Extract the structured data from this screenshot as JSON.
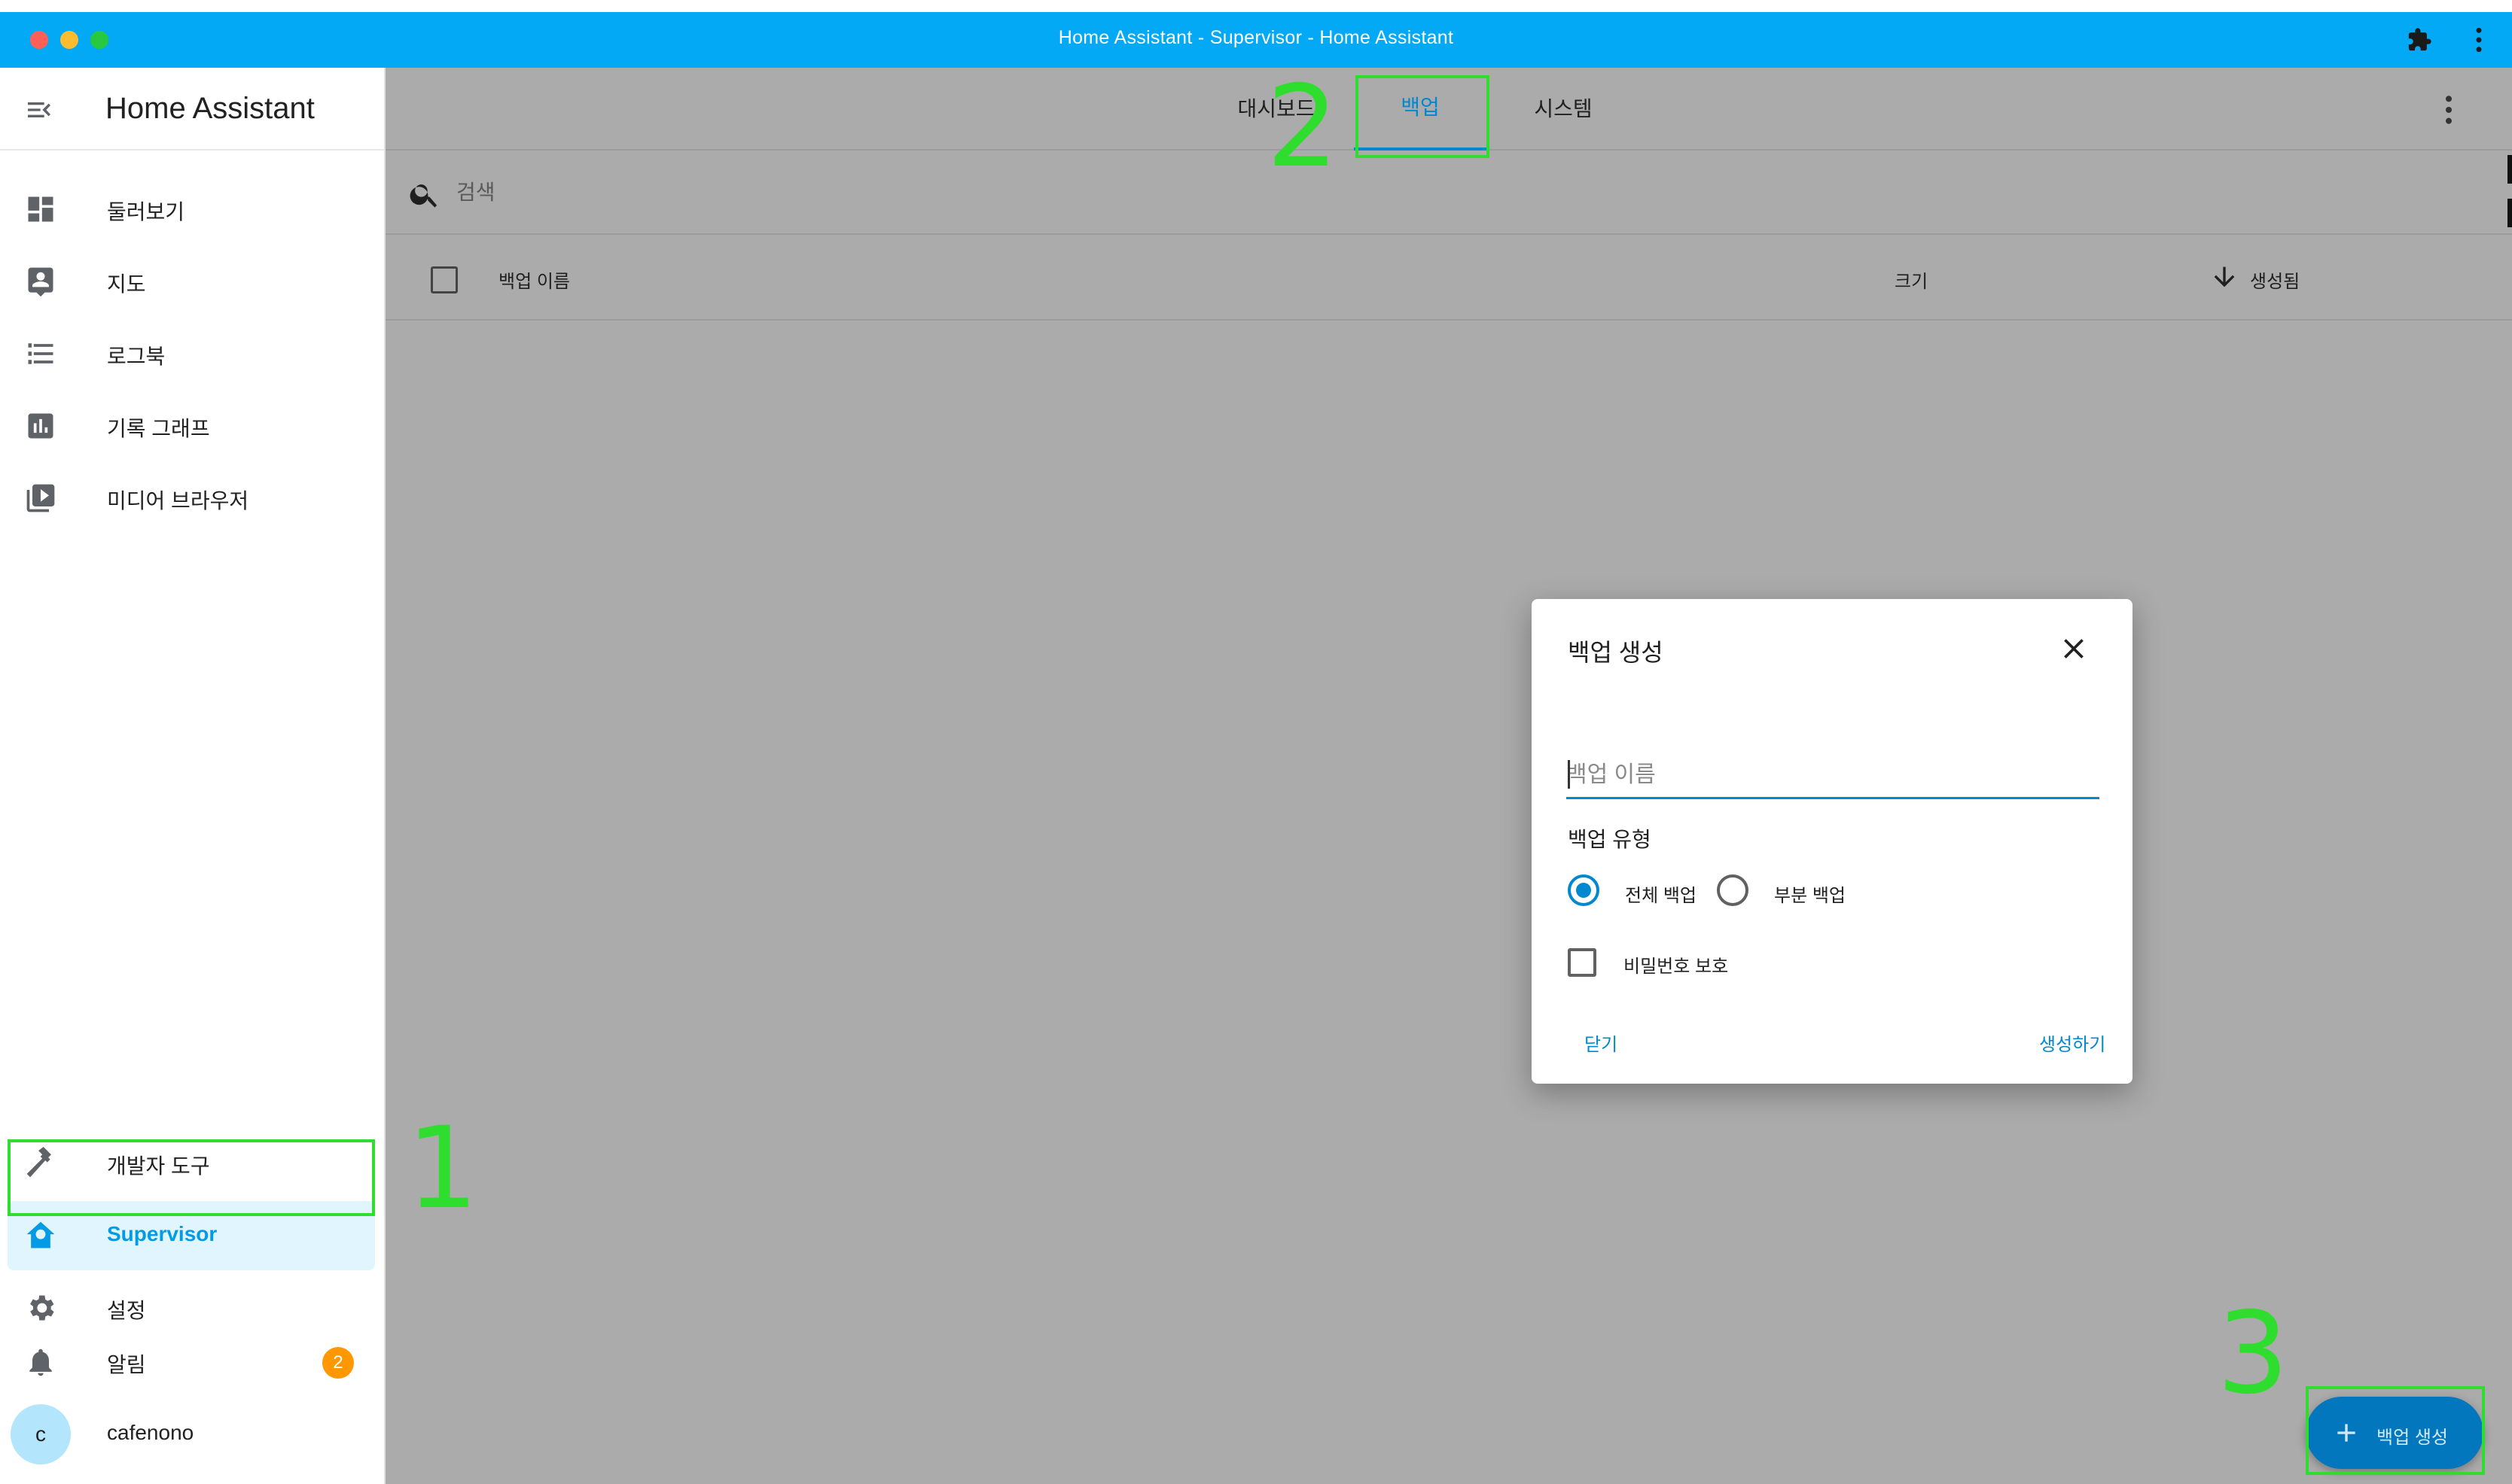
{
  "window": {
    "title": "Home Assistant - Supervisor - Home Assistant"
  },
  "sidebar": {
    "title": "Home Assistant",
    "items": [
      {
        "label": "둘러보기",
        "icon": "dashboard-icon"
      },
      {
        "label": "지도",
        "icon": "map-account-icon"
      },
      {
        "label": "로그북",
        "icon": "logbook-list-icon"
      },
      {
        "label": "기록 그래프",
        "icon": "history-chart-icon"
      },
      {
        "label": "미디어 브라우저",
        "icon": "media-play-icon"
      }
    ],
    "bottom_items": [
      {
        "label": "개발자 도구",
        "icon": "hammer-icon"
      },
      {
        "label": "Supervisor",
        "icon": "supervisor-home-icon",
        "active": true
      },
      {
        "label": "설정",
        "icon": "gear-icon"
      }
    ],
    "notifications": {
      "label": "알림",
      "count": "2"
    },
    "user": {
      "name": "cafenono",
      "initial": "c"
    }
  },
  "main": {
    "tabs": [
      {
        "label": "대시보드"
      },
      {
        "label": "백업",
        "active": true
      },
      {
        "label": "시스템"
      }
    ],
    "search": {
      "placeholder": "검색"
    },
    "table": {
      "columns": {
        "name": "백업 이름",
        "size": "크기",
        "created": "생성됨"
      }
    },
    "fab": {
      "label": "백업 생성"
    }
  },
  "dialog": {
    "title": "백업 생성",
    "name_placeholder": "백업 이름",
    "type_label": "백업 유형",
    "type_options": [
      {
        "label": "전체 백업",
        "selected": true
      },
      {
        "label": "부분 백업",
        "selected": false
      }
    ],
    "password_label": "비밀번호 보호",
    "password_checked": false,
    "cancel_label": "닫기",
    "create_label": "생성하기"
  },
  "annotations": [
    "1",
    "2",
    "3"
  ],
  "colors": {
    "primary": "#03a9f4",
    "accent_dark": "#0288d1",
    "badge": "#ff9800",
    "annotation": "#2fdd2f",
    "overlay": "#ababab"
  }
}
